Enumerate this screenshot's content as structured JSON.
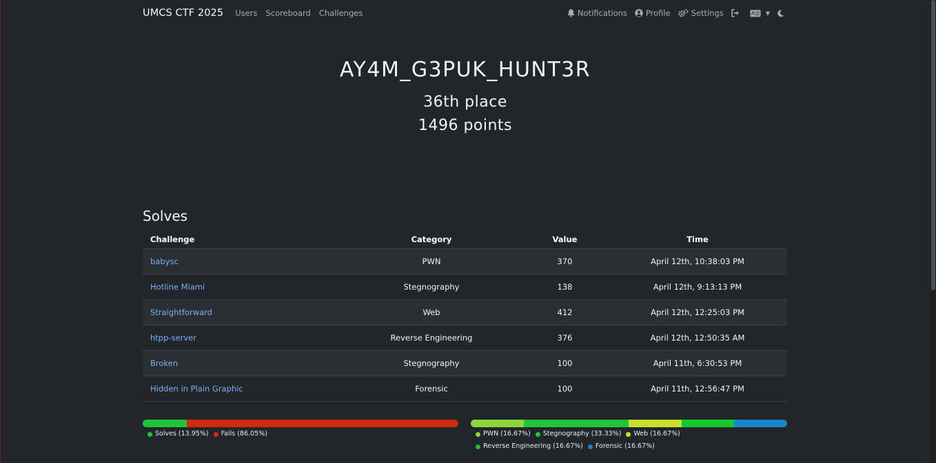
{
  "navbar": {
    "brand": "UMCS CTF 2025",
    "links": [
      "Users",
      "Scoreboard",
      "Challenges"
    ],
    "notifications": "Notifications",
    "profile": "Profile",
    "settings": "Settings"
  },
  "team": {
    "name": "AY4M_G3PUK_HUNT3R",
    "place": "36th place",
    "points": "1496 points"
  },
  "solves": {
    "title": "Solves",
    "headers": [
      "Challenge",
      "Category",
      "Value",
      "Time"
    ],
    "rows": [
      {
        "challenge": "babysc",
        "category": "PWN",
        "value": "370",
        "time": "April 12th, 10:38:03 PM"
      },
      {
        "challenge": "Hotline Miami",
        "category": "Stegnography",
        "value": "138",
        "time": "April 12th, 9:13:13 PM"
      },
      {
        "challenge": "Straightforward",
        "category": "Web",
        "value": "412",
        "time": "April 12th, 12:25:03 PM"
      },
      {
        "challenge": "htpp-server",
        "category": "Reverse Engineering",
        "value": "376",
        "time": "April 12th, 12:50:35 AM"
      },
      {
        "challenge": "Broken",
        "category": "Stegnography",
        "value": "100",
        "time": "April 11th, 6:30:53 PM"
      },
      {
        "challenge": "Hidden in Plain Graphic",
        "category": "Forensic",
        "value": "100",
        "time": "April 11th, 12:56:47 PM"
      }
    ]
  },
  "solve_stats": [
    {
      "label": "Solves (13.95%)",
      "percent": 13.95,
      "color": "#1ec53a"
    },
    {
      "label": "Fails (86.05%)",
      "percent": 86.05,
      "color": "#cf2c0d"
    }
  ],
  "category_stats": [
    {
      "label": "PWN (16.67%)",
      "percent": 16.67,
      "color": "#8ed43b"
    },
    {
      "label": "Stegnography (33.33%)",
      "percent": 33.33,
      "color": "#22c439"
    },
    {
      "label": "Web (16.67%)",
      "percent": 16.67,
      "color": "#c8df2e"
    },
    {
      "label": "Reverse Engineering (16.67%)",
      "percent": 16.67,
      "color": "#16c82f"
    },
    {
      "label": "Forensic (16.67%)",
      "percent": 16.67,
      "color": "#1a86c9"
    }
  ]
}
